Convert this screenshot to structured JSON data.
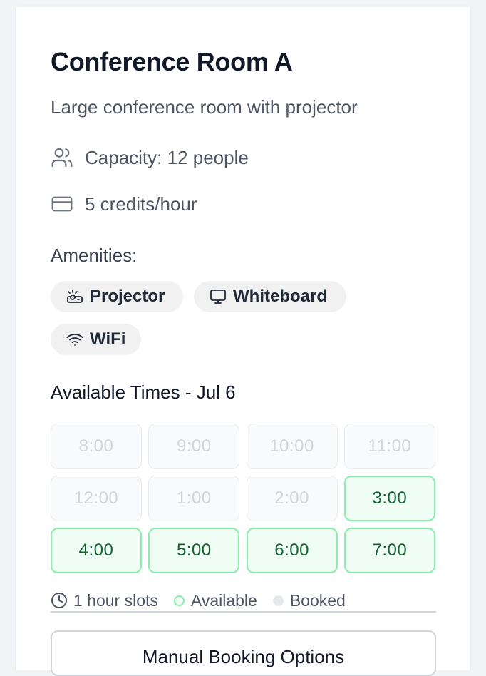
{
  "room": {
    "title": "Conference Room A",
    "description": "Large conference room with projector",
    "capacity_text": "Capacity: 12 people",
    "credits_text": "5 credits/hour",
    "icons": {
      "capacity": "users-icon",
      "credits": "credit-card-icon"
    }
  },
  "amenities": {
    "label": "Amenities:",
    "items": [
      {
        "label": "Projector",
        "icon": "projector-icon"
      },
      {
        "label": "Whiteboard",
        "icon": "monitor-icon"
      },
      {
        "label": "WiFi",
        "icon": "wifi-icon"
      }
    ]
  },
  "times": {
    "title": "Available Times - Jul 6",
    "slots": [
      {
        "label": "8:00",
        "status": "booked"
      },
      {
        "label": "9:00",
        "status": "booked"
      },
      {
        "label": "10:00",
        "status": "booked"
      },
      {
        "label": "11:00",
        "status": "booked"
      },
      {
        "label": "12:00",
        "status": "booked"
      },
      {
        "label": "1:00",
        "status": "booked"
      },
      {
        "label": "2:00",
        "status": "booked"
      },
      {
        "label": "3:00",
        "status": "available"
      },
      {
        "label": "4:00",
        "status": "available"
      },
      {
        "label": "5:00",
        "status": "available"
      },
      {
        "label": "6:00",
        "status": "available"
      },
      {
        "label": "7:00",
        "status": "available"
      }
    ]
  },
  "legend": {
    "slot_length": "1 hour slots",
    "available": "Available",
    "booked": "Booked"
  },
  "actions": {
    "manual_booking": "Manual Booking Options"
  },
  "colors": {
    "available_bg": "#f0fdf4",
    "available_border": "#86efac",
    "available_text": "#166534",
    "booked_text": "#d1d5db"
  }
}
